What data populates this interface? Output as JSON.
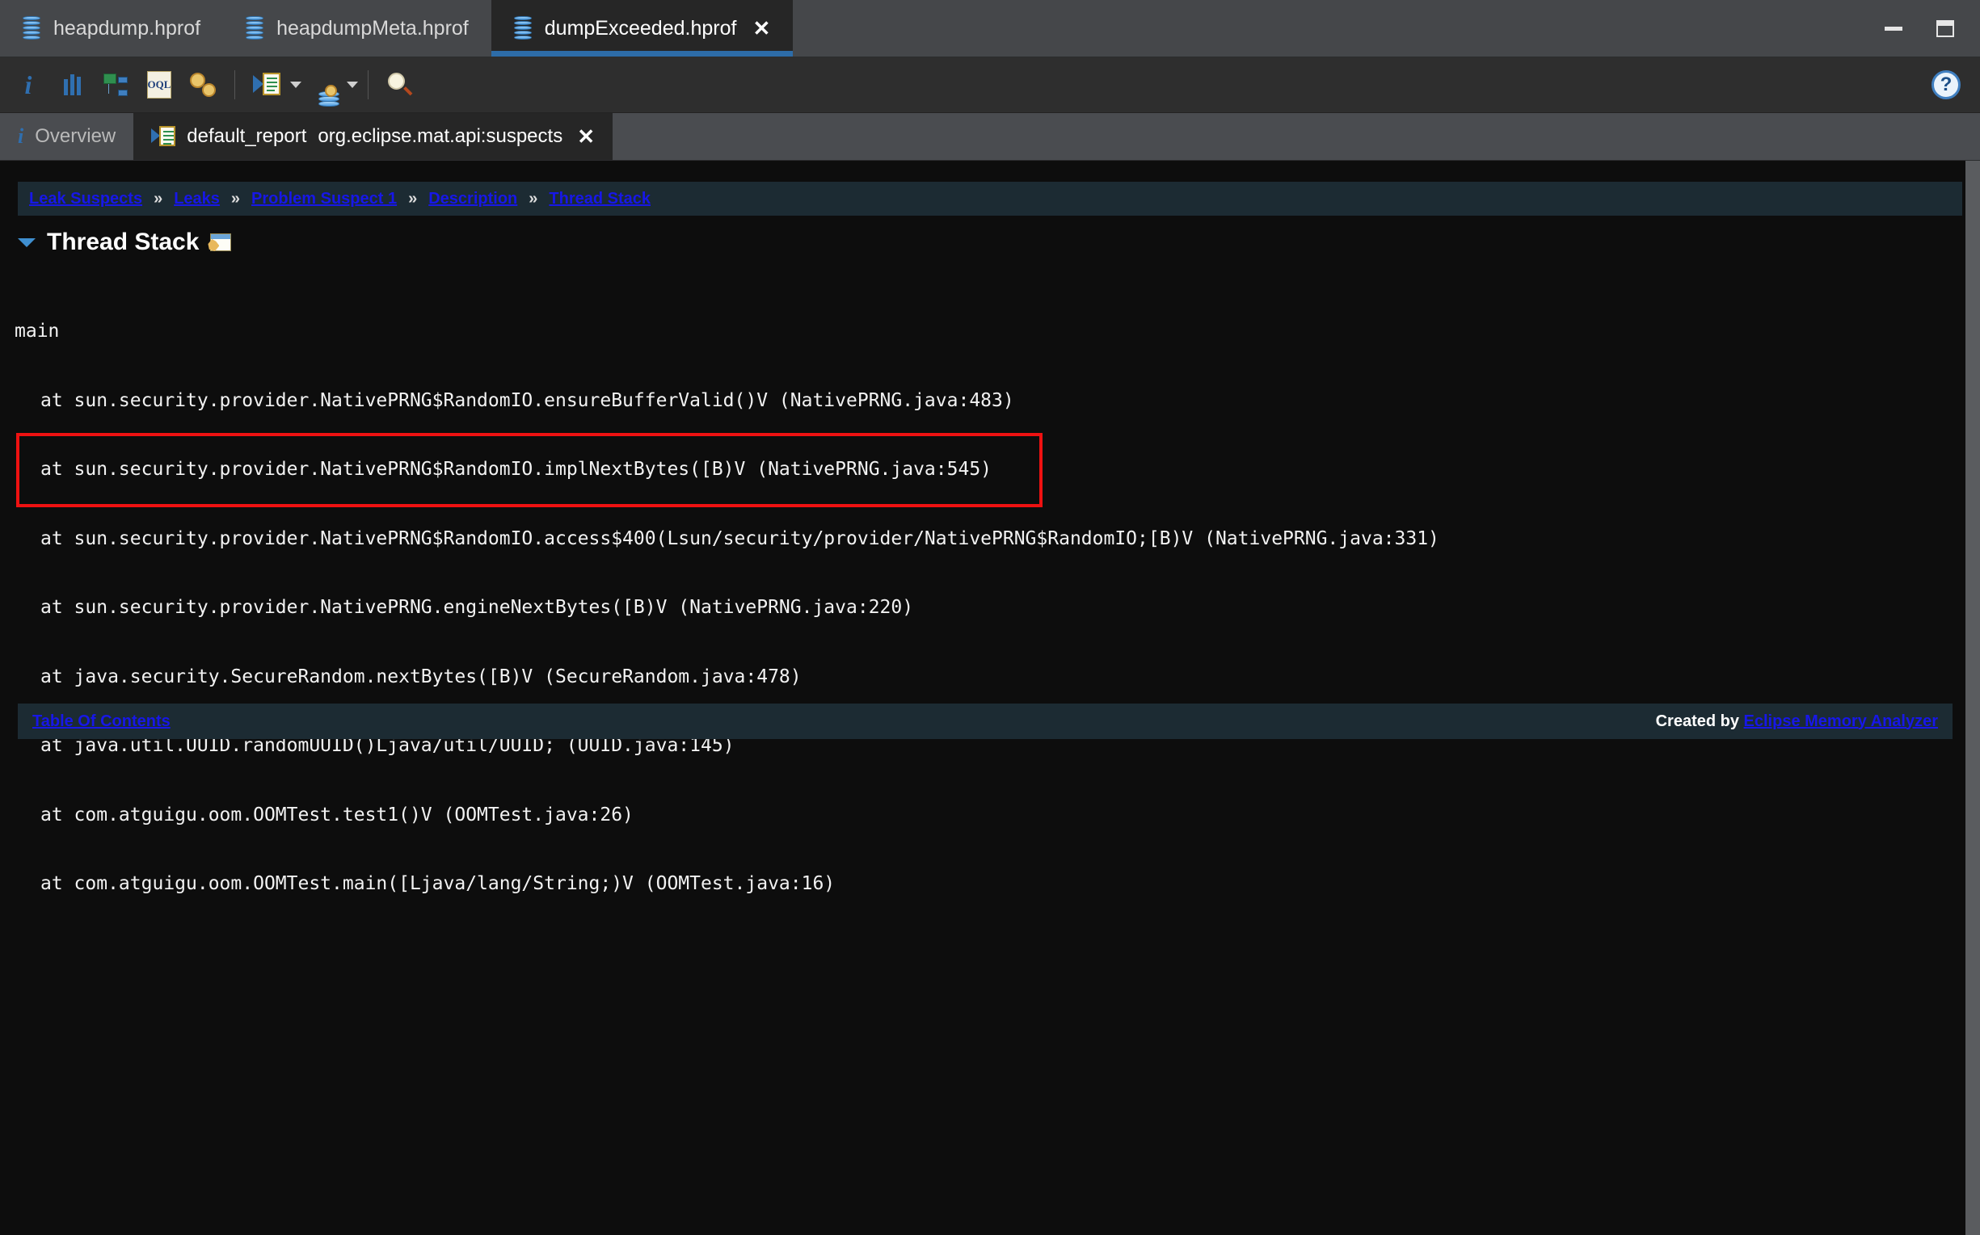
{
  "window": {
    "file_tabs": [
      {
        "label": "heapdump.hprof",
        "icon": "heap-dump-icon",
        "active": false,
        "closable": false
      },
      {
        "label": "heapdumpMeta.hprof",
        "icon": "heap-dump-icon",
        "active": false,
        "closable": false
      },
      {
        "label": "dumpExceeded.hprof",
        "icon": "heap-dump-icon",
        "active": true,
        "closable": true,
        "close_label": "✕"
      }
    ],
    "controls": {
      "minimize": "minimize-icon",
      "maximize": "maximize-icon"
    }
  },
  "toolbar": {
    "items": [
      {
        "name": "overview-info-icon",
        "glyph": "i"
      },
      {
        "name": "histogram-icon"
      },
      {
        "name": "dominator-tree-icon"
      },
      {
        "name": "oql-icon",
        "glyph": "OQL"
      },
      {
        "name": "calculate-retained-size-icon"
      },
      {
        "name": "run-report-icon",
        "has_dropdown": true
      },
      {
        "name": "query-browser-icon",
        "has_dropdown": true
      },
      {
        "name": "find-object-icon"
      }
    ],
    "help": "?"
  },
  "editor_tabs": [
    {
      "name": "tab-overview",
      "icon": "info-icon",
      "label": "Overview",
      "active": false,
      "closable": false
    },
    {
      "name": "tab-default-report",
      "icon": "report-icon",
      "label": "default_report",
      "label_secondary": "org.eclipse.mat.api:suspects",
      "active": true,
      "closable": true,
      "close_label": "✕"
    }
  ],
  "report": {
    "breadcrumb": {
      "separator": "»",
      "items": [
        "Leak Suspects",
        "Leaks",
        "Problem Suspect 1",
        "Description",
        "Thread Stack"
      ]
    },
    "section": {
      "title": "Thread Stack",
      "icon": "thread-stack-icon",
      "expanded": true
    },
    "thread_name": "main",
    "frames": [
      "at sun.security.provider.NativePRNG$RandomIO.ensureBufferValid()V (NativePRNG.java:483)",
      "at sun.security.provider.NativePRNG$RandomIO.implNextBytes([B)V (NativePRNG.java:545)",
      "at sun.security.provider.NativePRNG$RandomIO.access$400(Lsun/security/provider/NativePRNG$RandomIO;[B)V (NativePRNG.java:331)",
      "at sun.security.provider.NativePRNG.engineNextBytes([B)V (NativePRNG.java:220)",
      "at java.security.SecureRandom.nextBytes([B)V (SecureRandom.java:478)",
      "at java.util.UUID.randomUUID()Ljava/util/UUID; (UUID.java:145)",
      "at com.atguigu.oom.OOMTest.test1()V (OOMTest.java:26)",
      "at com.atguigu.oom.OOMTest.main([Ljava/lang/String;)V (OOMTest.java:16)"
    ],
    "highlight": {
      "color": "#ee1111",
      "first_frame_index": 5,
      "last_frame_index": 7
    },
    "footer": {
      "toc_label": "Table Of Contents",
      "created_prefix": "Created by ",
      "created_link": "Eclipse Memory Analyzer"
    }
  },
  "colors": {
    "titlebar_bg": "#45474a",
    "toolbar_bg": "#2e2e2e",
    "editor_tabbar_bg": "#4a4c50",
    "content_bg": "#0d0d0d",
    "panel_bg": "#1c2b33",
    "link": "#1717e8",
    "active_tab_underline": "#2d6ca8",
    "highlight_red": "#ee1111"
  }
}
